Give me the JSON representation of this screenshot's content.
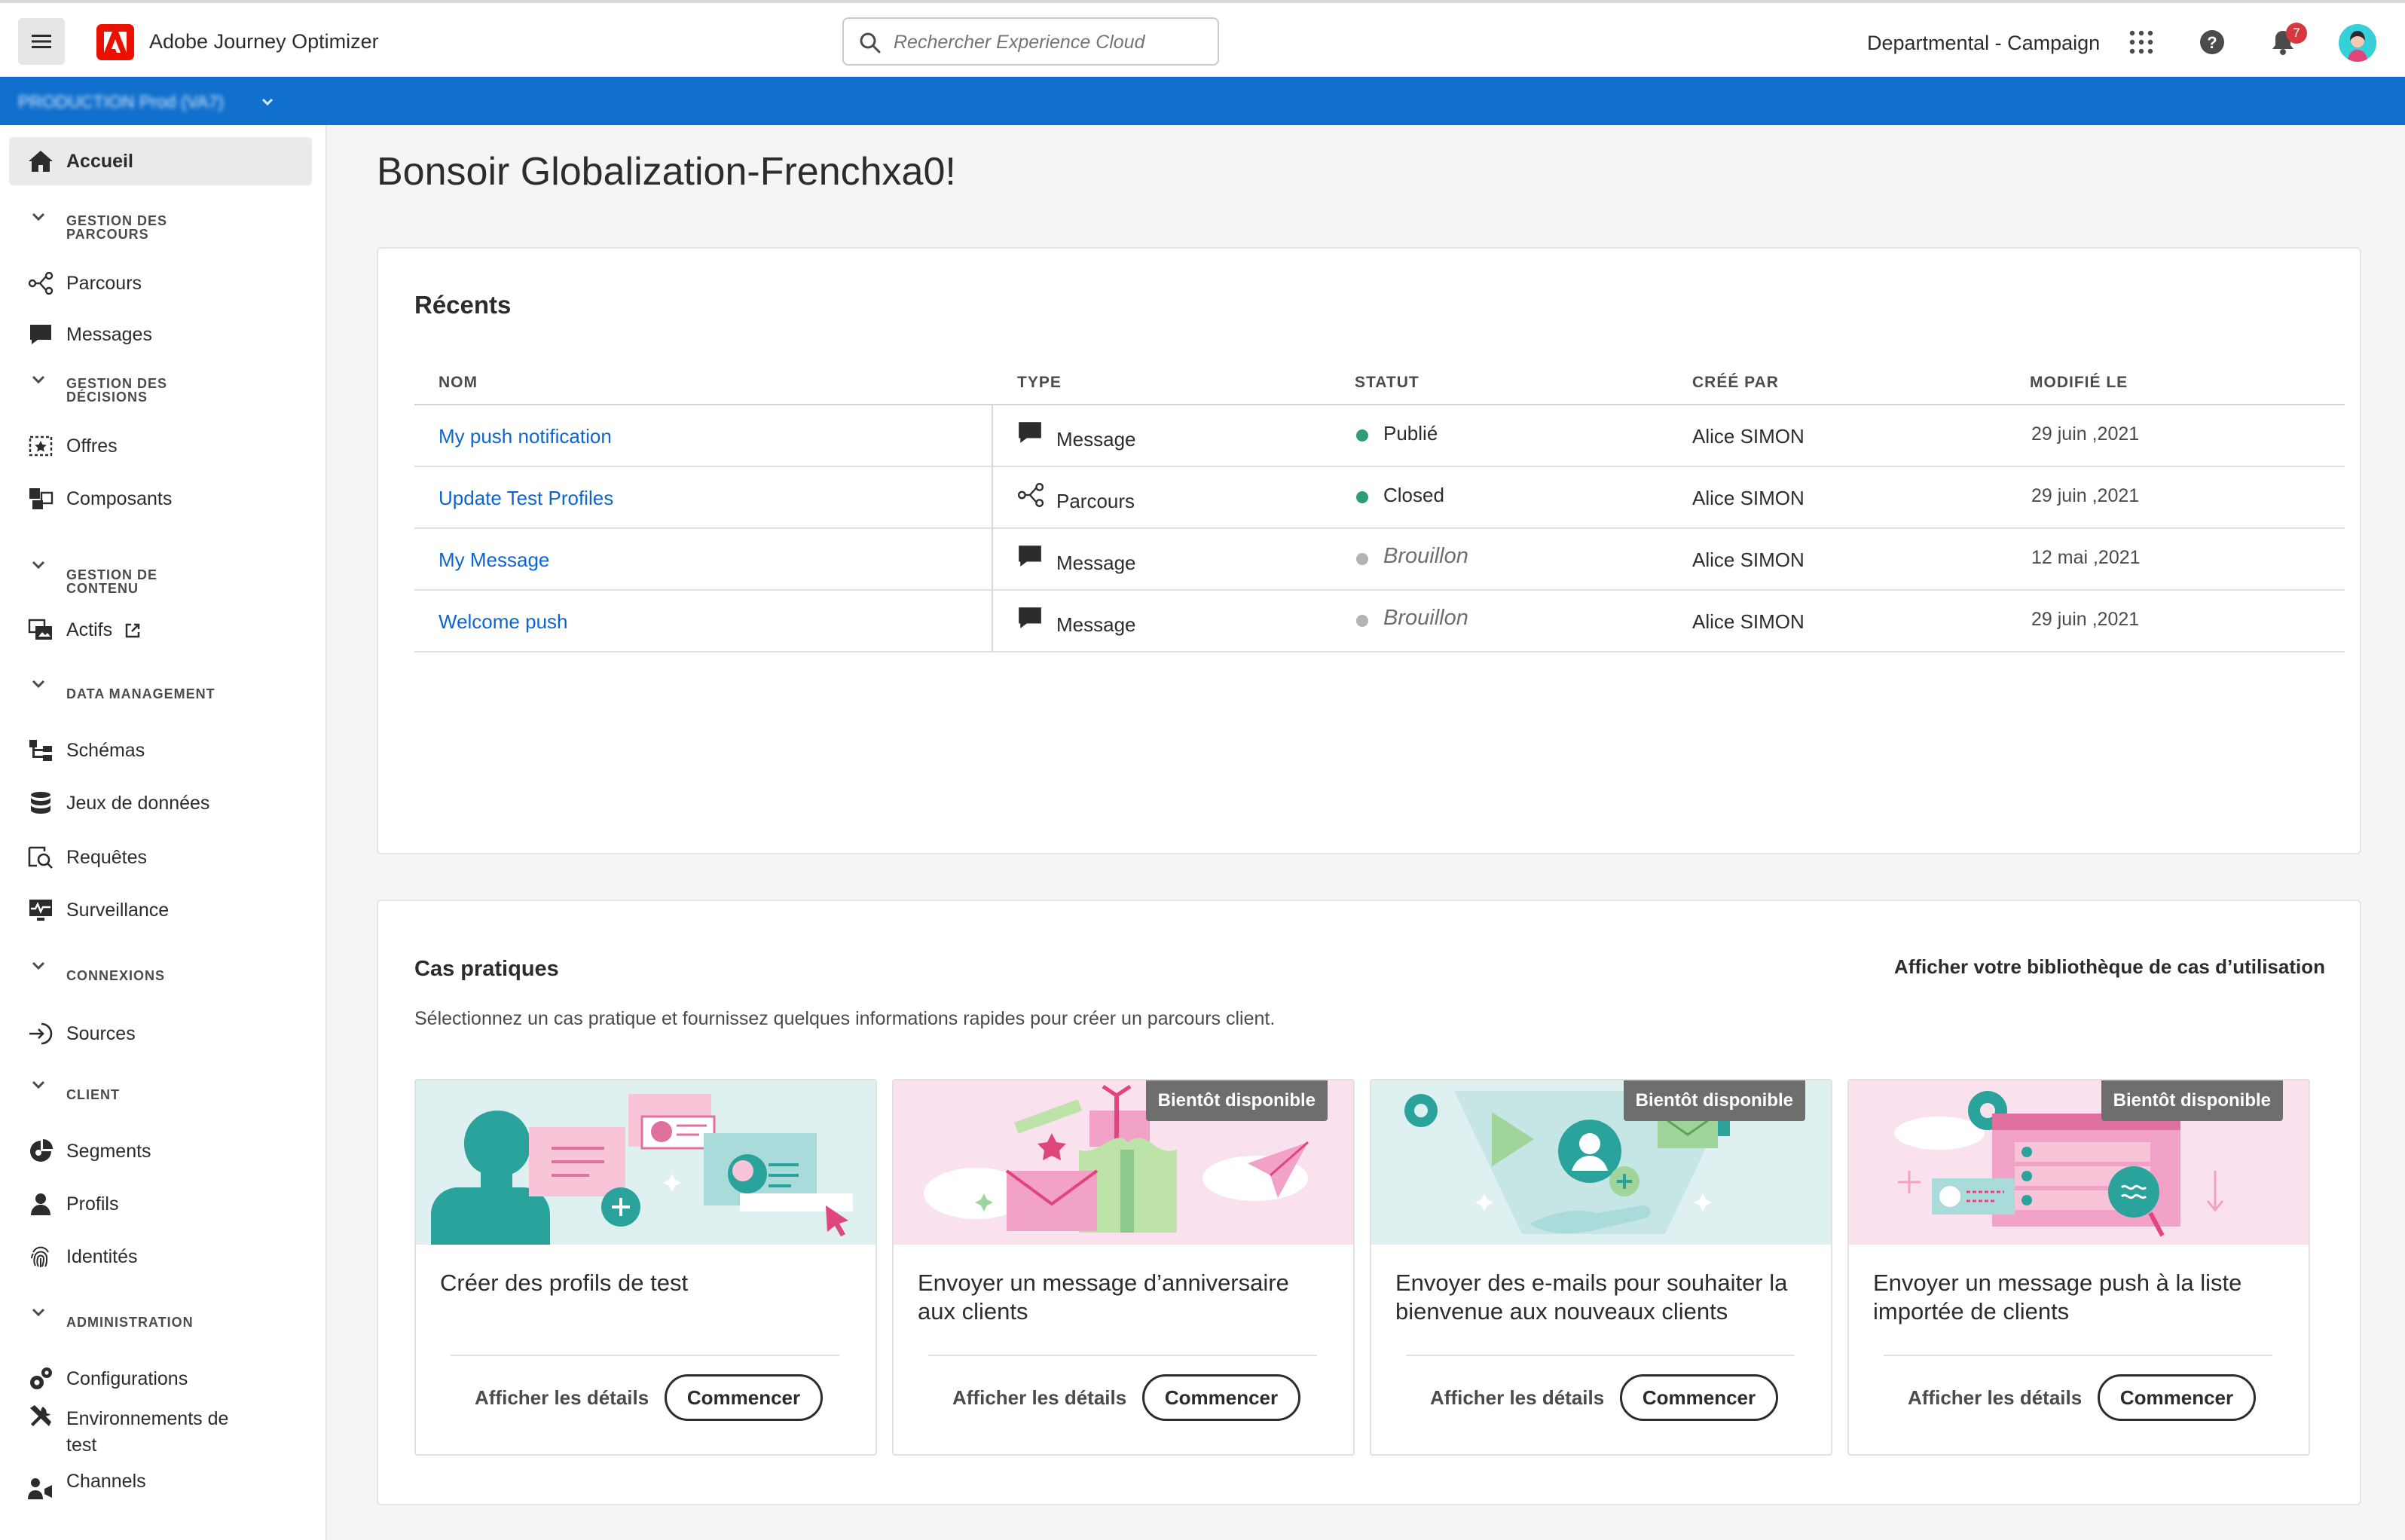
{
  "app": {
    "title": "Adobe Journey Optimizer",
    "org": "Departmental - Campaign",
    "notifications": "7"
  },
  "search": {
    "placeholder": "Rechercher Experience Cloud"
  },
  "sandbox": {
    "label": "PRODUCTION Prod (VA7)"
  },
  "colors": {
    "accent": "#1170cd",
    "link": "#0d66d0",
    "published": "#2d9d78",
    "draft": "#b3b3b3",
    "brand": "#eb1000"
  },
  "sidebar": {
    "home": "Accueil",
    "sections": {
      "journeys": "GESTION DES PARCOURS",
      "decisions": "GESTION DES DÉCISIONS",
      "content": "GESTION DE CONTENU",
      "data": "DATA MANAGEMENT",
      "connections": "CONNEXIONS",
      "client": "CLIENT",
      "admin": "ADMINISTRATION"
    },
    "items": {
      "parcours": "Parcours",
      "messages": "Messages",
      "offres": "Offres",
      "composants": "Composants",
      "actifs": "Actifs",
      "schemas": "Schémas",
      "datasets": "Jeux de données",
      "requetes": "Requêtes",
      "surveillance": "Surveillance",
      "sources": "Sources",
      "segments": "Segments",
      "profils": "Profils",
      "identites": "Identités",
      "configurations": "Configurations",
      "environnements": "Environnements de test",
      "channels": "Channels"
    }
  },
  "greeting": "Bonsoir Globalization-Frenchxa0!",
  "recents": {
    "title": "Récents",
    "columns": {
      "name": "NOM",
      "type": "TYPE",
      "status": "STATUT",
      "author": "CRÉÉ PAR",
      "modified": "MODIFIÉ LE"
    },
    "rows": [
      {
        "name": "My push notification",
        "type": "Message",
        "type_icon": "message-icon",
        "status": "Publié",
        "status_kind": "published",
        "author": "Alice SIMON",
        "date": "29 juin ,2021"
      },
      {
        "name": "Update Test Profiles",
        "type": "Parcours",
        "type_icon": "journey-icon",
        "status": "Closed",
        "status_kind": "published",
        "author": "Alice SIMON",
        "date": "29 juin ,2021"
      },
      {
        "name": "My Message",
        "type": "Message",
        "type_icon": "message-icon",
        "status": "Brouillon",
        "status_kind": "draft",
        "author": "Alice SIMON",
        "date": "12 mai ,2021"
      },
      {
        "name": "Welcome push",
        "type": "Message",
        "type_icon": "message-icon",
        "status": "Brouillon",
        "status_kind": "draft",
        "author": "Alice SIMON",
        "date": "29 juin ,2021"
      }
    ]
  },
  "usecases": {
    "title": "Cas pratiques",
    "library_link": "Afficher votre bibliothèque de cas d’utilisation",
    "description": "Sélectionnez un cas pratique et fournissez quelques informations rapides pour créer un parcours client.",
    "details_label": "Afficher les détails",
    "start_label": "Commencer",
    "badge_label": "Bientôt disponible",
    "tiles": [
      {
        "title": "Créer des profils de test",
        "coming_soon": false
      },
      {
        "title": "Envoyer un message d’anniversaire aux clients",
        "coming_soon": true
      },
      {
        "title": "Envoyer des e-mails pour souhaiter la bienvenue aux nouveaux clients",
        "coming_soon": true
      },
      {
        "title": "Envoyer un message push à la liste importée de clients",
        "coming_soon": true
      }
    ]
  }
}
